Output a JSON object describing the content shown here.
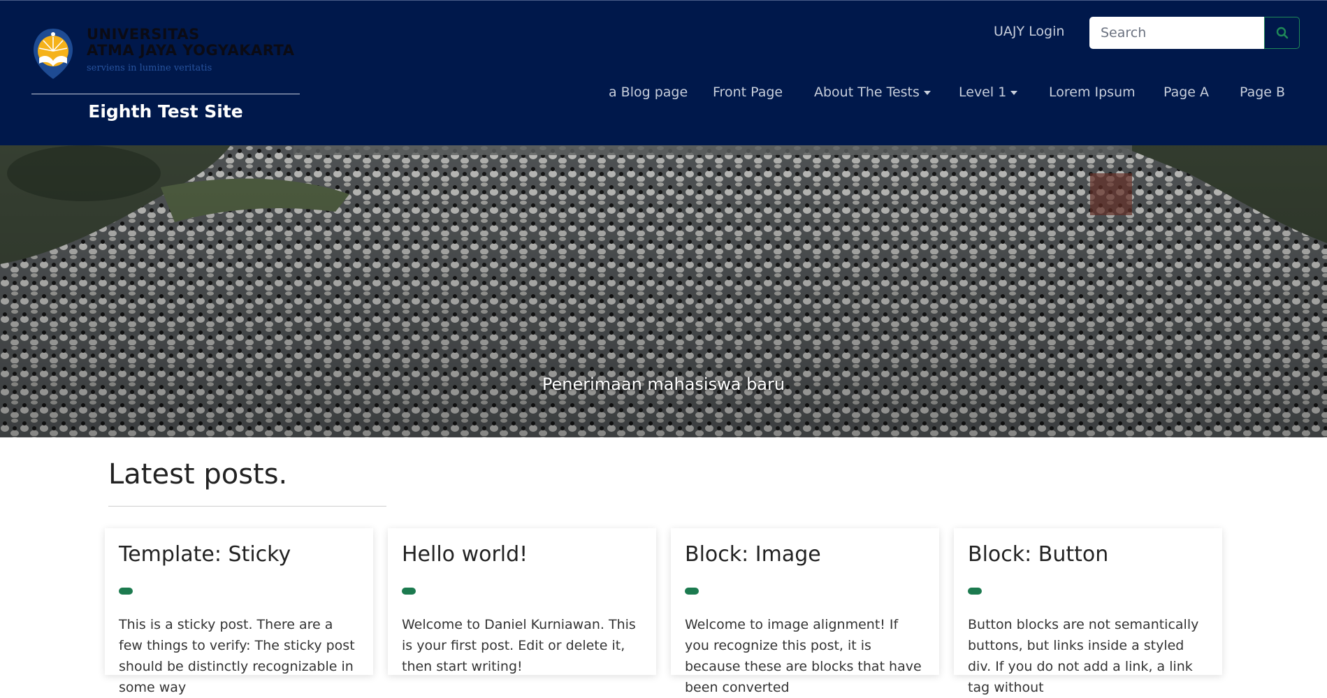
{
  "header": {
    "logo": {
      "line1": "UNIVERSITAS",
      "line2": "ATMA JAYA YOGYAKARTA",
      "tagline": "serviens in lumine veritatis"
    },
    "site_title": "Eighth Test Site",
    "login_label": "UAJY Login",
    "search": {
      "placeholder": "Search"
    },
    "nav": [
      {
        "label": "a Blog page",
        "dropdown": false
      },
      {
        "label": "Front Page",
        "dropdown": false
      },
      {
        "label": "About The Tests",
        "dropdown": true
      },
      {
        "label": "Level 1",
        "dropdown": true
      },
      {
        "label": "Lorem Ipsum",
        "dropdown": false
      },
      {
        "label": "Page A",
        "dropdown": false
      },
      {
        "label": "Page B",
        "dropdown": false
      }
    ]
  },
  "hero": {
    "caption": "Penerimaan mahasiswa baru"
  },
  "latest": {
    "title": "Latest posts.",
    "posts": [
      {
        "title": "Template: Sticky",
        "excerpt": "This is a sticky post. There are a few things to verify: The sticky post should be distinctly recognizable in some way"
      },
      {
        "title": "Hello world!",
        "excerpt": "Welcome to Daniel Kurniawan. This is your first post. Edit or delete it, then start writing!"
      },
      {
        "title": "Block: Image",
        "excerpt": "Welcome to image alignment! If you recognize this post, it is because these are blocks that have been converted"
      },
      {
        "title": "Block: Button",
        "excerpt": "Button blocks are not semantically buttons, but links inside a styled div.  If you do not add a link, a link tag without"
      }
    ]
  },
  "colors": {
    "header_bg": "#00184b",
    "accent_green": "#1c7a4f",
    "nav_text": "#c8cfdc"
  },
  "icons": {
    "search": "search-icon"
  }
}
